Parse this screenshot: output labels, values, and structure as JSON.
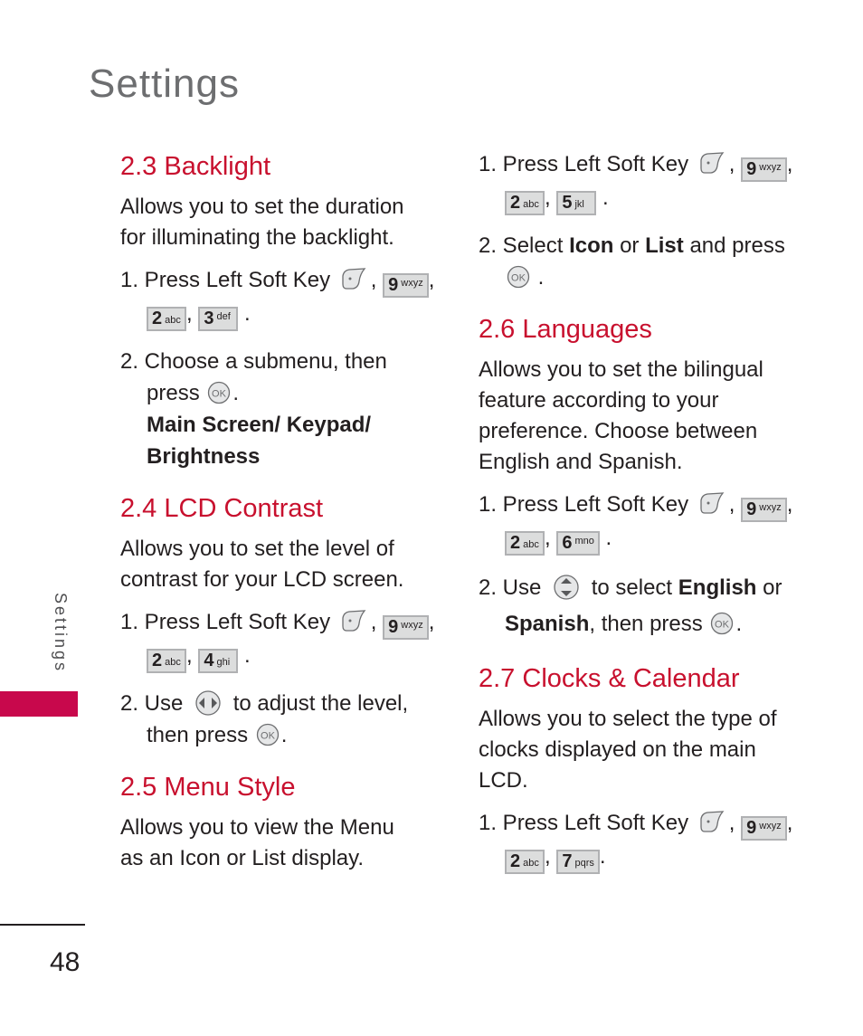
{
  "page": {
    "title": "Settings",
    "side_label": "Settings",
    "page_number": "48",
    "accent_color": "#c8102e",
    "tab_color": "#c8084c"
  },
  "icons": {
    "left_soft_key": "left-soft-key-icon",
    "ok_key": "ok-key-icon",
    "nav_left_right": "nav-left-right-icon",
    "nav_up_down": "nav-up-down-icon",
    "ok_label": "OK"
  },
  "sections": {
    "backlight": {
      "heading": "2.3 Backlight",
      "description": "Allows you to set the duration for illuminating the backlight.",
      "step1_prefix": "1. Press Left Soft Key",
      "keys": [
        {
          "num": "9",
          "letters": "wxyz"
        },
        {
          "num": "2",
          "letters": "abc"
        },
        {
          "num": "3",
          "letters": "def"
        }
      ],
      "step2_text": "2. Choose a submenu, then",
      "step2_press": "press",
      "options": "Main Screen/ Keypad/ Brightness"
    },
    "lcd_contrast": {
      "heading": "2.4 LCD Contrast",
      "description": "Allows you to set the level of contrast for your LCD screen.",
      "step1_prefix": "1. Press Left Soft Key",
      "keys": [
        {
          "num": "9",
          "letters": "wxyz"
        },
        {
          "num": "2",
          "letters": "abc"
        },
        {
          "num": "4",
          "letters": "ghi"
        }
      ],
      "step2_use": "2. Use",
      "step2_rest": "to adjust the level,",
      "step2_then": "then press"
    },
    "menu_style": {
      "heading": "2.5 Menu Style",
      "description": "Allows you to view the Menu as an Icon or List display.",
      "step1_prefix": "1. Press Left Soft Key",
      "keys": [
        {
          "num": "9",
          "letters": "wxyz"
        },
        {
          "num": "2",
          "letters": "abc"
        },
        {
          "num": "5",
          "letters": "jkl"
        }
      ],
      "step2_select": "2. Select",
      "opt1": "Icon",
      "or": "or",
      "opt2": "List",
      "and_press": "and press"
    },
    "languages": {
      "heading": "2.6 Languages",
      "description": "Allows you to set the bilingual feature according to your preference. Choose between English and Spanish.",
      "step1_prefix": "1. Press Left Soft Key",
      "keys": [
        {
          "num": "9",
          "letters": "wxyz"
        },
        {
          "num": "2",
          "letters": "abc"
        },
        {
          "num": "6",
          "letters": "mno"
        }
      ],
      "step2_use": "2. Use",
      "step2_select": "to select",
      "opt1": "English",
      "or": "or",
      "opt2": "Spanish",
      "then_press": ", then press"
    },
    "clocks": {
      "heading": "2.7 Clocks & Calendar",
      "description": "Allows you to select the type of clocks displayed on the main LCD.",
      "step1_prefix": "1. Press Left Soft Key",
      "keys": [
        {
          "num": "9",
          "letters": "wxyz"
        },
        {
          "num": "2",
          "letters": "abc"
        },
        {
          "num": "7",
          "letters": "pqrs"
        }
      ]
    }
  }
}
